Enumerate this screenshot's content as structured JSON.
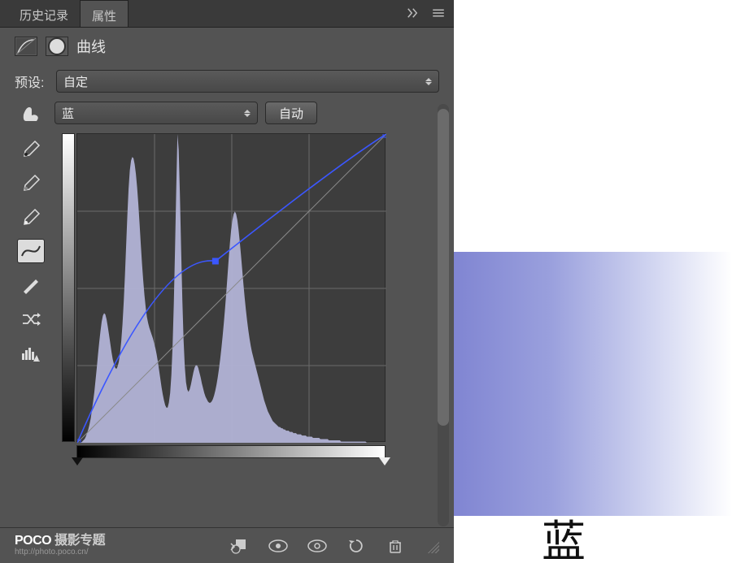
{
  "tabs": {
    "history": "历史记录",
    "properties": "属性"
  },
  "adjustment": {
    "title": "曲线"
  },
  "preset": {
    "label": "预设:",
    "selected": "自定"
  },
  "channel": {
    "selected": "蓝",
    "auto_label": "自动"
  },
  "chart_data": {
    "type": "line",
    "xlim": [
      0,
      255
    ],
    "ylim": [
      0,
      255
    ],
    "grid": true,
    "channel": "blue",
    "curve_points": [
      {
        "x": 0,
        "y": 0
      },
      {
        "x": 114,
        "y": 150
      },
      {
        "x": 255,
        "y": 255
      }
    ],
    "histogram": [
      0,
      0,
      0,
      0,
      1,
      2,
      3,
      5,
      8,
      11,
      15,
      20,
      27,
      34,
      42,
      52,
      62,
      73,
      83,
      92,
      100,
      105,
      107,
      106,
      102,
      96,
      89,
      82,
      75,
      69,
      65,
      62,
      61,
      63,
      67,
      74,
      84,
      98,
      116,
      138,
      163,
      188,
      210,
      225,
      233,
      236,
      235,
      230,
      222,
      211,
      197,
      181,
      164,
      148,
      134,
      122,
      112,
      104,
      99,
      95,
      92,
      89,
      86,
      82,
      78,
      73,
      67,
      60,
      53,
      46,
      40,
      35,
      31,
      29,
      29,
      33,
      41,
      56,
      80,
      115,
      160,
      210,
      255,
      242,
      205,
      160,
      118,
      85,
      63,
      50,
      44,
      42,
      44,
      48,
      53,
      58,
      62,
      64,
      64,
      62,
      58,
      54,
      49,
      45,
      41,
      38,
      36,
      34,
      33,
      33,
      34,
      36,
      39,
      43,
      48,
      54,
      61,
      69,
      78,
      88,
      99,
      111,
      124,
      138,
      152,
      165,
      176,
      184,
      189,
      191,
      189,
      184,
      176,
      166,
      155,
      143,
      131,
      120,
      110,
      101,
      93,
      86,
      80,
      75,
      71,
      67,
      63,
      59,
      55,
      51,
      47,
      43,
      39,
      35,
      32,
      29,
      26,
      24,
      22,
      20,
      18,
      17,
      16,
      15,
      14,
      13,
      13,
      12,
      12,
      11,
      11,
      10,
      10,
      10,
      9,
      9,
      9,
      8,
      8,
      8,
      7,
      7,
      7,
      7,
      6,
      6,
      6,
      6,
      5,
      5,
      5,
      5,
      5,
      4,
      4,
      4,
      4,
      4,
      4,
      3,
      3,
      3,
      3,
      3,
      3,
      3,
      2,
      2,
      2,
      2,
      2,
      2,
      2,
      2,
      2,
      2,
      1,
      1,
      1,
      1,
      1,
      1,
      1,
      1,
      1,
      1,
      1,
      1,
      1,
      1,
      1,
      1,
      1,
      1,
      1,
      1,
      1,
      0,
      0,
      0,
      0,
      0,
      0,
      0,
      0,
      0,
      0,
      0,
      0,
      0,
      0,
      0,
      0,
      0
    ]
  },
  "footer": {
    "brand_strong": "POCO",
    "brand_rest": " 摄影专题",
    "url": "http://photo.poco.cn/"
  },
  "preview": {
    "label": "蓝"
  }
}
